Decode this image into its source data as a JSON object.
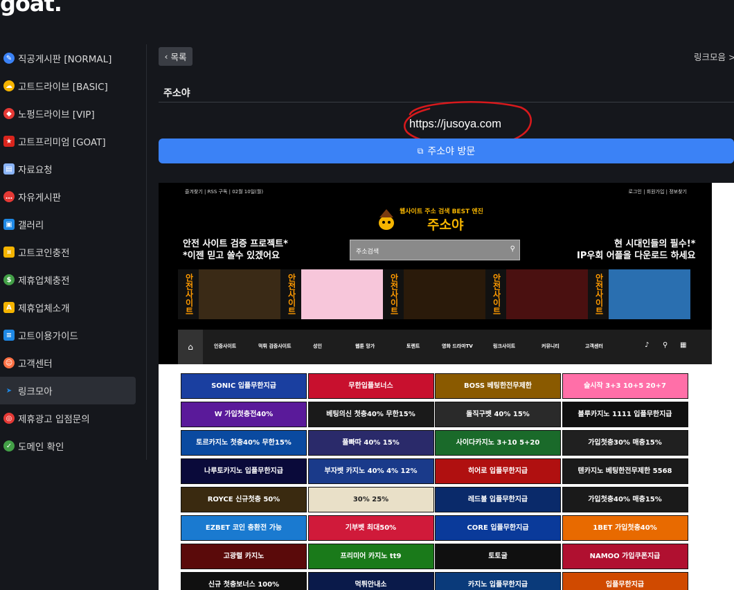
{
  "logo": {
    "text": "goat."
  },
  "sidebar": {
    "items": [
      {
        "label": "직공게시판 [NORMAL]",
        "icon": "pencil-icon",
        "color": "#3b82f6"
      },
      {
        "label": "고트드라이브 [BASIC]",
        "icon": "cloud-icon",
        "color": "#f5b400"
      },
      {
        "label": "노펑드라이브 [VIP]",
        "icon": "gem-icon",
        "color": "#e53935"
      },
      {
        "label": "고트프리미엄 [GOAT]",
        "icon": "vietnam-flag-icon",
        "color": "#da251d"
      },
      {
        "label": "자료요청",
        "icon": "clipboard-icon",
        "color": "#8ab4f8"
      },
      {
        "label": "자유게시판",
        "icon": "chat-bubble-icon",
        "color": "#e53935"
      },
      {
        "label": "갤러리",
        "icon": "picture-icon",
        "color": "#1e88e5"
      },
      {
        "label": "고트코인충전",
        "icon": "coin-icon",
        "color": "#f5b400"
      },
      {
        "label": "제휴업체충전",
        "icon": "dollar-icon",
        "color": "#43a047"
      },
      {
        "label": "제휴업체소개",
        "icon": "ads-icon",
        "color": "#f5b400"
      },
      {
        "label": "고트이용가이드",
        "icon": "document-icon",
        "color": "#1e88e5"
      },
      {
        "label": "고객센터",
        "icon": "support-agent-icon",
        "color": "#ff7043"
      },
      {
        "label": "링크모아",
        "icon": "cursor-icon",
        "color": "#1e88e5"
      },
      {
        "label": "제휴광고 입점문의",
        "icon": "target-icon",
        "color": "#e53935"
      },
      {
        "label": "도메인 확인",
        "icon": "check-circle-icon",
        "color": "#43a047"
      }
    ],
    "active_index": 12
  },
  "main": {
    "back_label": "목록",
    "breadcrumb": "링크모음 >",
    "title": "주소야",
    "url": "https://jusoya.com",
    "visit_label": "주소야 방문"
  },
  "screenshot": {
    "topbar_left": "즐겨찾기   |   RSS 구독   |   02월 10일(월)",
    "topbar_right": "로그인   |   회원가입   |   정보찾기",
    "brand_tag": "웹사이트 주소 검색 BEST 엔진",
    "brand_name": "주소야",
    "promo_left_1": "안전 사이트 검증 프로젝트*",
    "promo_left_2": "*이젠 믿고 쓸수 있겠어요",
    "promo_right_1": "현 시대인들의 필수!*",
    "promo_right_2": "IP우회 어플을 다운로드 하세요",
    "search_placeholder": "주소검색",
    "strip_label": "안전사이트",
    "menu": [
      "인증사이트",
      "먹튀 검증사이트",
      "성인",
      "웹툰 망가",
      "토렌트",
      "영화 드라마TV",
      "링크사이트",
      "커뮤니티",
      "고객센터"
    ],
    "banners": [
      [
        "SONIC 입플무한지급",
        "무한입플보너스",
        "BOSS 베팅한전무제한",
        "슬시작 3+3 10+5 20+7"
      ],
      [
        "W 가입첫충전40%",
        "베팅의신 첫충40% 무한15%",
        "돌직구벳 40% 15%",
        "블루카지노 1111 입플무한지급"
      ],
      [
        "토르카지노 첫충40% 무한15%",
        "풀빠따 40% 15%",
        "사이다카지노 3+10 5+20",
        "가입첫충30% 매충15%"
      ],
      [
        "나루토카지노 입플무한지급",
        "부자벳 카지노 40% 4% 12%",
        "히어로 입플무한지급",
        "텐카지노 베팅한전무제한 5568"
      ],
      [
        "ROYCE 신규첫충 50%",
        "30% 25%",
        "레드불 입플무한지급",
        "가입첫충40% 매충15%"
      ],
      [
        "EZBET 코인 충환전 가능",
        "기부벳 최대50%",
        "CORE 입플무한지급",
        "1BET 가입첫충40%"
      ],
      [
        "고광렬 카지노",
        "프리미어 카지노 tt9",
        "토토굴",
        "NAMOO 가입쿠폰지급"
      ],
      [
        "신규 첫충보너스 100%",
        "먹튀안내소",
        "카지노 입플무한지급",
        "입플무한지급"
      ]
    ]
  }
}
